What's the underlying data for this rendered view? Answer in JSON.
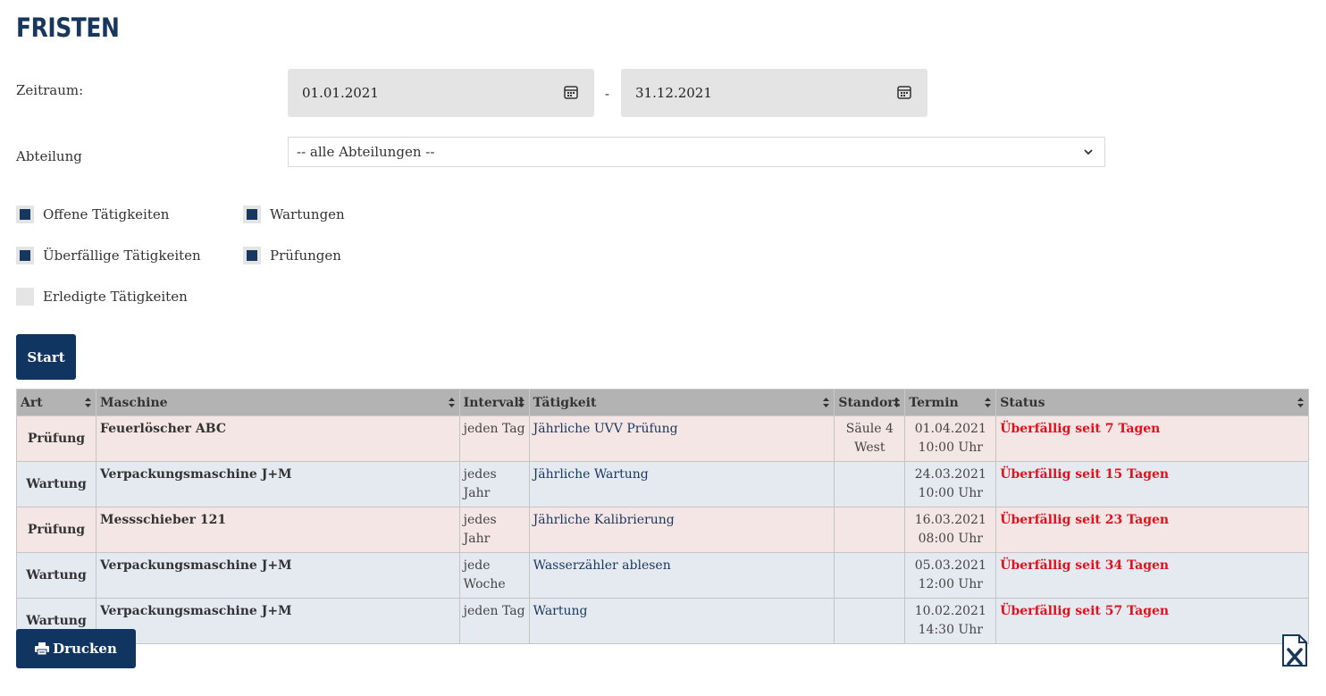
{
  "page": {
    "title": "FRISTEN"
  },
  "filters": {
    "zeitraum_label": "Zeitraum:",
    "date_from": "01.01.2021",
    "date_separator": "-",
    "date_to": "31.12.2021",
    "abteilung_label": "Abteilung",
    "abteilung_value": "-- alle Abteilungen --"
  },
  "checkboxes": {
    "offene": {
      "label": "Offene Tätigkeiten",
      "checked": true
    },
    "ueberfaellige": {
      "label": "Überfällige Tätigkeiten",
      "checked": true
    },
    "erledigte": {
      "label": "Erledigte Tätigkeiten",
      "checked": false
    },
    "wartungen": {
      "label": "Wartungen",
      "checked": true
    },
    "pruefungen": {
      "label": "Prüfungen",
      "checked": true
    }
  },
  "buttons": {
    "start": "Start",
    "drucken": "Drucken"
  },
  "icons": {
    "calendar": "calendar-icon",
    "chevron": "chevron-down-icon",
    "sort": "sort-icon",
    "print": "printer-icon",
    "excel": "excel-export-icon"
  },
  "colors": {
    "primary": "#17375e",
    "button": "#0f3560",
    "status_overdue": "#e0111c",
    "row_pruefung": "#f5e6e6",
    "row_wartung": "#e5eaf1",
    "header_bg": "#b3b3b3"
  },
  "table": {
    "columns": [
      "Art",
      "Maschine",
      "Intervall",
      "Tätigkeit",
      "Standort",
      "Termin",
      "Status"
    ],
    "rows": [
      {
        "type": "pruefung",
        "art": "Prüfung",
        "maschine": "Feuerlöscher ABC",
        "intervall": "jeden Tag",
        "taetigkeit": "Jährliche UVV Prüfung",
        "standort": "Säule 4 West",
        "termin_date": "01.04.2021",
        "termin_time": "10:00 Uhr",
        "status": "Überfällig seit 7 Tagen"
      },
      {
        "type": "wartung",
        "art": "Wartung",
        "maschine": "Verpackungsmaschine J+M",
        "intervall": "jedes Jahr",
        "taetigkeit": "Jährliche Wartung",
        "standort": "",
        "termin_date": "24.03.2021",
        "termin_time": "10:00 Uhr",
        "status": "Überfällig seit 15 Tagen"
      },
      {
        "type": "pruefung",
        "art": "Prüfung",
        "maschine": "Messschieber 121",
        "intervall": "jedes Jahr",
        "taetigkeit": "Jährliche Kalibrierung",
        "standort": "",
        "termin_date": "16.03.2021",
        "termin_time": "08:00 Uhr",
        "status": "Überfällig seit 23 Tagen"
      },
      {
        "type": "wartung",
        "art": "Wartung",
        "maschine": "Verpackungsmaschine J+M",
        "intervall": "jede Woche",
        "taetigkeit": "Wasserzähler ablesen",
        "standort": "",
        "termin_date": "05.03.2021",
        "termin_time": "12:00 Uhr",
        "status": "Überfällig seit 34 Tagen"
      },
      {
        "type": "wartung",
        "art": "Wartung",
        "maschine": "Verpackungsmaschine J+M",
        "intervall": "jeden Tag",
        "taetigkeit": "Wartung",
        "standort": "",
        "termin_date": "10.02.2021",
        "termin_time": "14:30 Uhr",
        "status": "Überfällig seit 57 Tagen"
      }
    ]
  }
}
